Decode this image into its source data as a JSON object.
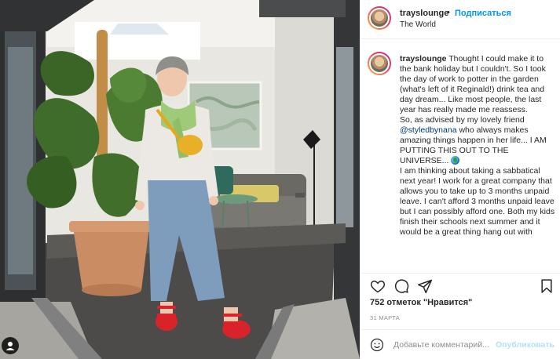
{
  "post": {
    "username": "trayslounge",
    "separator": "•",
    "follow_label": "Подписаться",
    "location": "The World"
  },
  "photo": {
    "alt": "Woman in denim and red sandals standing beside a large potted monstera plant",
    "corner_icon": "user-profile-icon"
  },
  "caption": {
    "username": "trayslounge",
    "p1": "Thought I could make it to the bank holiday but I couldn't. So I took the day of work to potter in the garden (what's left of it Reginald!) drink tea and day dream... Like most people, the last year has really made me reassess.",
    "p2_before": "So, as advised by my lovely friend ",
    "mention": "@styledbynana",
    "p2_after": " who always makes amazing things happen in her life... I AM PUTTING THIS OUT TO THE UNIVERSE...",
    "p3": "I am thinking about taking a sabbatical next year! I work for a great company that allows you to take up to 3 months unpaid leave. I can't afford 3 months unpaid leave but I can possibly afford one. Both my kids finish their schools next summer and it would be a great thing hang out with"
  },
  "actions": {
    "like_icon": "heart-icon",
    "comment_icon": "comment-icon",
    "share_icon": "share-icon",
    "save_icon": "bookmark-icon"
  },
  "likes_text": "752 отметок \"Нравится\"",
  "date_text": "31 МАРТА",
  "comment_box": {
    "emoji_icon": "smile-icon",
    "placeholder": "Добавьте комментарий...",
    "publish_label": "Опубликовать"
  },
  "colors": {
    "link_blue": "#0095f6",
    "publish_disabled": "#b2dffc",
    "mention": "#00376b",
    "muted": "#8e8e8e"
  }
}
